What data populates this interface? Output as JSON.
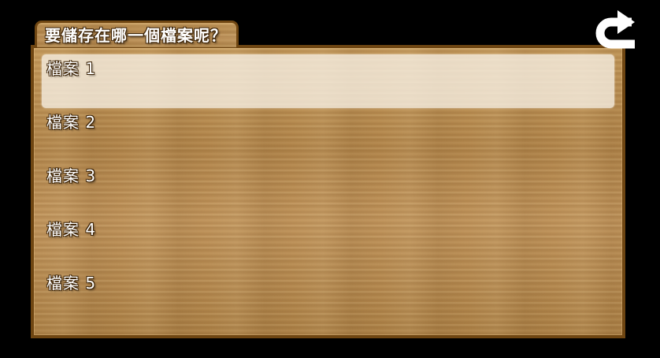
{
  "window": {
    "title": "要儲存在哪一個檔案呢？"
  },
  "toolbar": {
    "back_icon": "return-arrow-icon"
  },
  "save_slots": [
    {
      "label": "檔案 1",
      "selected": true
    },
    {
      "label": "檔案 2",
      "selected": false
    },
    {
      "label": "檔案 3",
      "selected": false
    },
    {
      "label": "檔案 4",
      "selected": false
    },
    {
      "label": "檔案 5",
      "selected": false
    }
  ],
  "colors": {
    "frame_border": "#6f4612",
    "wood": "#b58b4f",
    "highlight": "#f5eee1",
    "text": "#ffffff",
    "background": "#000000"
  }
}
